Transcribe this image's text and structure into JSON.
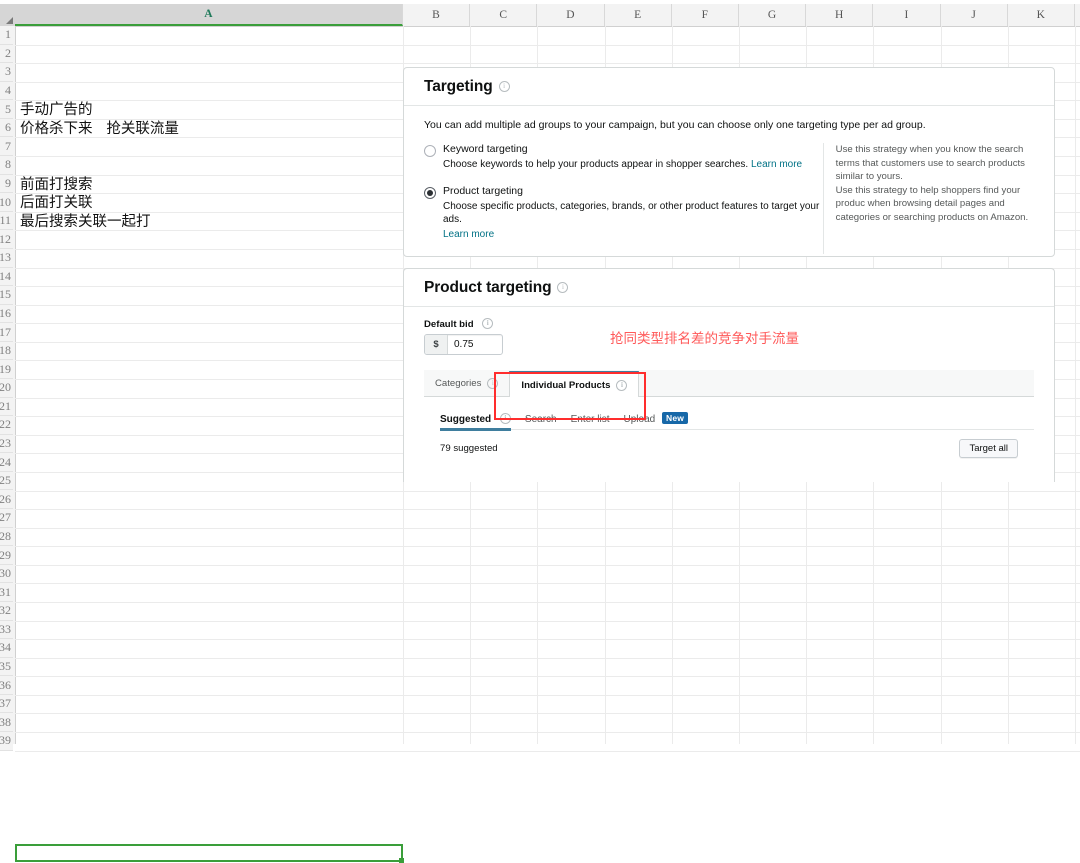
{
  "spreadsheet": {
    "columns": [
      "A",
      "B",
      "C",
      "D",
      "E",
      "F",
      "G",
      "H",
      "I",
      "J",
      "K"
    ],
    "selected_column": "A",
    "selected_cell_row": 45,
    "cells": [
      {
        "row": 5,
        "text": "手动广告的"
      },
      {
        "row": 6,
        "text": "价格杀下来   抢关联流量"
      },
      {
        "row": 9,
        "text": "前面打搜索"
      },
      {
        "row": 10,
        "text": "后面打关联"
      },
      {
        "row": 11,
        "text": "最后搜索关联一起打"
      }
    ]
  },
  "targeting_panel": {
    "title": "Targeting",
    "info_icon": "info-icon",
    "lead": "You can add multiple ad groups to your campaign, but you can choose only one targeting type per ad group.",
    "options": [
      {
        "label": "Keyword targeting",
        "description": "Choose keywords to help your products appear in shopper searches.",
        "link": "Learn more",
        "selected": false
      },
      {
        "label": "Product targeting",
        "description": "Choose specific products, categories, brands, or other product features to target your ads.",
        "link": "Learn more",
        "selected": true
      }
    ],
    "help_text_1": "Use this strategy when you know the search terms that customers use to search products similar to yours.",
    "help_text_2": "Use this strategy to help shoppers find your produc when browsing detail pages and categories or searching products on Amazon."
  },
  "product_targeting_panel": {
    "title": "Product targeting",
    "default_bid_label": "Default bid",
    "currency_symbol": "$",
    "default_bid_value": "0.75",
    "tabs": [
      {
        "label": "Categories",
        "active": false
      },
      {
        "label": "Individual Products",
        "active": true
      }
    ],
    "sub_tabs": [
      {
        "label": "Suggested",
        "active": true,
        "badge": ""
      },
      {
        "label": "Search",
        "active": false,
        "badge": ""
      },
      {
        "label": "Enter list",
        "active": false,
        "badge": ""
      },
      {
        "label": "Upload",
        "active": false,
        "badge": "New"
      }
    ],
    "suggested_count": "79 suggested",
    "target_all_label": "Target all"
  },
  "annotations": {
    "red_note": "抢同类型排名差的竞争对手流量",
    "red_note_color": "#ff5a5a",
    "highlight_box_color": "#ff2d2d"
  }
}
